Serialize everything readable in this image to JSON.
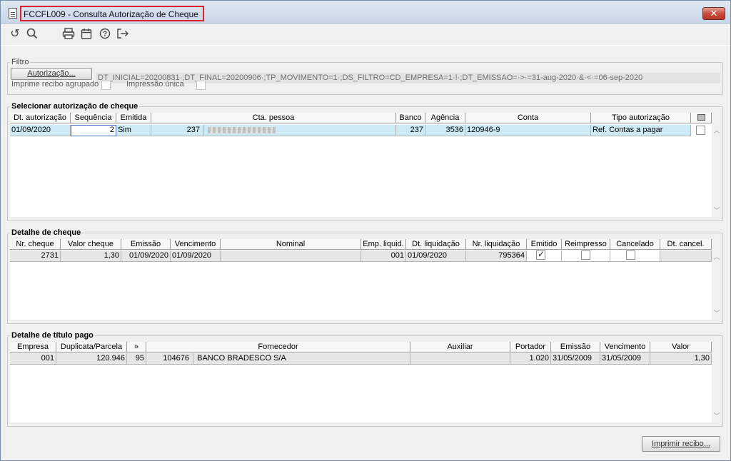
{
  "window": {
    "title": "FCCFL009 - Consulta Autorização de Cheque",
    "close_label": "✕"
  },
  "toolbar": {
    "refresh": "↺",
    "search": "🔍",
    "print": "🖶",
    "calendar": "📅",
    "help": "?",
    "exit": "⇥"
  },
  "filtro": {
    "legend": "Filtro",
    "autorizacao_button": "Autorização...",
    "filter_text": "DT_INICIAL=20200831·;DT_FINAL=20200906·;TP_MOVIMENTO=1·;DS_FILTRO=CD_EMPRESA=1·!·;DT_EMISSAO=·>·=31-aug-2020·&·<·=06-sep-2020",
    "imprime_recibo_label": "Imprime recibo agrupado",
    "impressao_unica_label": "Impressão única"
  },
  "autorizacao": {
    "legend": "Selecionar autorização de cheque",
    "headers": [
      "Dt. autorização",
      "Sequência",
      "Emitida",
      "Cta. pessoa",
      "Banco",
      "Agência",
      "Conta",
      "Tipo autorização"
    ],
    "row": {
      "dt_autorizacao": "01/09/2020",
      "sequencia": "2",
      "emitida": "Sim",
      "cta_pessoa": "237",
      "banco": "237",
      "agencia": "3536",
      "conta": "120946-9",
      "tipo": "Ref. Contas a pagar"
    }
  },
  "cheque": {
    "legend": "Detalhe de cheque",
    "headers": [
      "Nr. cheque",
      "Valor cheque",
      "Emissão",
      "Vencimento",
      "Nominal",
      "Emp. liquid.",
      "Dt. liquidação",
      "Nr. liquidação",
      "Emitido",
      "Reimpresso",
      "Cancelado",
      "Dt. cancel."
    ],
    "row": {
      "nr_cheque": "2731",
      "valor": "1,30",
      "emissao": "01/09/2020",
      "vencimento": "01/09/2020",
      "nominal": "",
      "emp_liquid": "001",
      "dt_liquidacao": "01/09/2020",
      "nr_liquidacao": "795364",
      "emitido": true,
      "reimpresso": false,
      "cancelado": false,
      "dt_cancel": ""
    }
  },
  "titulo": {
    "legend": "Detalhe de título pago",
    "headers": [
      "Empresa",
      "Duplicata/Parcela",
      "»",
      "Fornecedor",
      "Auxiliar",
      "Portador",
      "Emissão",
      "Vencimento",
      "Valor"
    ],
    "row": {
      "empresa": "001",
      "duplicata": "120.946",
      "parcela": "95",
      "fornecedor_cod": "104676",
      "fornecedor_nome": "BANCO BRADESCO S/A",
      "auxiliar": "",
      "portador": "1.020",
      "emissao": "31/05/2009",
      "vencimento": "31/05/2009",
      "valor": "1,30"
    }
  },
  "footer": {
    "imprimir_button": "Imprimir recibo..."
  }
}
